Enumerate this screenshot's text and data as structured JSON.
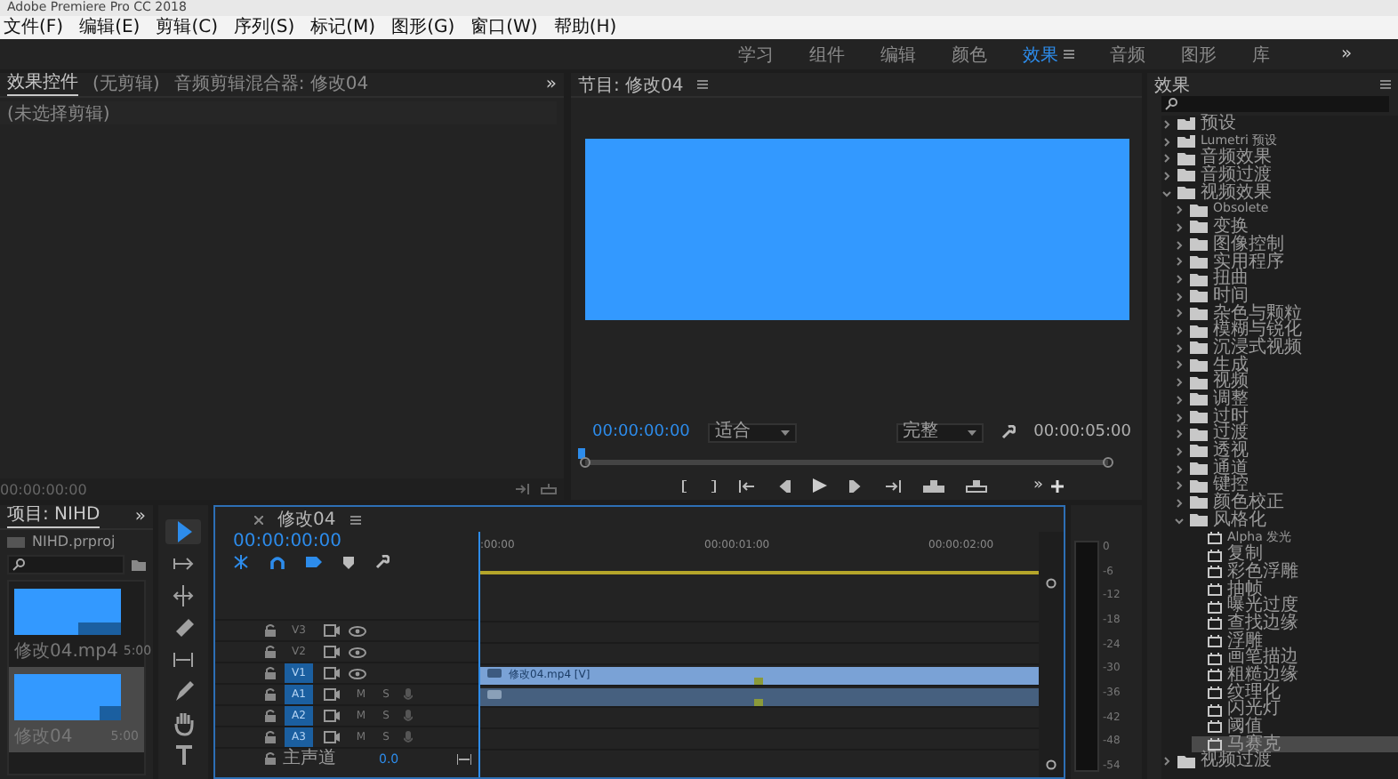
{
  "window": {
    "title": "Adobe Premiere Pro CC 2018"
  },
  "menu": [
    "文件(F)",
    "编辑(E)",
    "剪辑(C)",
    "序列(S)",
    "标记(M)",
    "图形(G)",
    "窗口(W)",
    "帮助(H)"
  ],
  "workspaces": [
    {
      "label": "学习",
      "selected": false
    },
    {
      "label": "组件",
      "selected": false
    },
    {
      "label": "编辑",
      "selected": false
    },
    {
      "label": "颜色",
      "selected": false
    },
    {
      "label": "效果",
      "selected": true
    },
    {
      "label": "音频",
      "selected": false
    },
    {
      "label": "图形",
      "selected": false
    },
    {
      "label": "库",
      "selected": false
    }
  ],
  "workspace_overflow": "»",
  "source_panel": {
    "tabs": [
      {
        "label": "效果控件",
        "selected": true
      },
      {
        "label": "(无剪辑)",
        "selected": false
      },
      {
        "label": "音频剪辑混合器: 修改04",
        "selected": false
      }
    ],
    "overflow": "»",
    "subheader": "(未选择剪辑)",
    "timecode": "00:00:00:00"
  },
  "program": {
    "title": "节目: 修改04",
    "timecode": "00:00:00:00",
    "zoom": "适合",
    "quality": "完整",
    "duration": "00:00:05:00",
    "overflow": "»"
  },
  "project": {
    "title": "项目: NIHD",
    "overflow": "»",
    "file": "NIHD.prproj",
    "items": [
      {
        "name": "修改04.mp4",
        "duration": "5:00",
        "kind": "clip",
        "selected": false
      },
      {
        "name": "修改04",
        "duration": "5:00",
        "kind": "sequence",
        "selected": true
      }
    ]
  },
  "tools": [
    {
      "kind": "select",
      "selected": true
    },
    {
      "kind": "track-select",
      "selected": false
    },
    {
      "kind": "ripple",
      "selected": false
    },
    {
      "kind": "razor",
      "selected": false
    },
    {
      "kind": "slip",
      "selected": false
    },
    {
      "kind": "pen",
      "selected": false
    },
    {
      "kind": "hand",
      "selected": false
    },
    {
      "kind": "type",
      "selected": false
    }
  ],
  "timeline": {
    "title": "修改04",
    "timecode": "00:00:00:00",
    "ruler": [
      ":00:00",
      "00:00:01:00",
      "00:00:02:00"
    ],
    "tracks": [
      {
        "kind": "video",
        "name": "V3",
        "targeted": false
      },
      {
        "kind": "video",
        "name": "V2",
        "targeted": false
      },
      {
        "kind": "video",
        "name": "V1",
        "targeted": true,
        "has_clip": true,
        "clip": "修改04.mp4 [V]"
      },
      {
        "kind": "audio",
        "name": "A1",
        "targeted": true,
        "mute": "M",
        "solo": "S",
        "has_clip": true
      },
      {
        "kind": "audio",
        "name": "A2",
        "targeted": true,
        "mute": "M",
        "solo": "S"
      },
      {
        "kind": "audio",
        "name": "A3",
        "targeted": true,
        "mute": "M",
        "solo": "S"
      },
      {
        "kind": "master",
        "name": "主声道",
        "value": "0.0"
      }
    ]
  },
  "meter": {
    "scale": [
      "0",
      "-6",
      "-12",
      "-18",
      "-24",
      "-30",
      "-36",
      "-42",
      "-48",
      "-54"
    ]
  },
  "effects": {
    "title": "效果",
    "tree": [
      {
        "label": "预设",
        "kind": "preset",
        "expanded": false,
        "selected": false
      },
      {
        "label": "Lumetri 预设",
        "kind": "preset",
        "expanded": false,
        "selected": false
      },
      {
        "label": "音频效果",
        "kind": "folder",
        "expanded": false,
        "selected": false
      },
      {
        "label": "音频过渡",
        "kind": "folder",
        "expanded": false,
        "selected": false
      },
      {
        "label": "视频效果",
        "kind": "folder",
        "expanded": true,
        "selected": false,
        "children": [
          {
            "label": "Obsolete",
            "kind": "folder",
            "expanded": false,
            "selected": false
          },
          {
            "label": "变换",
            "kind": "folder",
            "expanded": false,
            "selected": false
          },
          {
            "label": "图像控制",
            "kind": "folder",
            "expanded": false,
            "selected": false
          },
          {
            "label": "实用程序",
            "kind": "folder",
            "expanded": false,
            "selected": false
          },
          {
            "label": "扭曲",
            "kind": "folder",
            "expanded": false,
            "selected": false
          },
          {
            "label": "时间",
            "kind": "folder",
            "expanded": false,
            "selected": false
          },
          {
            "label": "杂色与颗粒",
            "kind": "folder",
            "expanded": false,
            "selected": false
          },
          {
            "label": "模糊与锐化",
            "kind": "folder",
            "expanded": false,
            "selected": false
          },
          {
            "label": "沉浸式视频",
            "kind": "folder",
            "expanded": false,
            "selected": false
          },
          {
            "label": "生成",
            "kind": "folder",
            "expanded": false,
            "selected": false
          },
          {
            "label": "视频",
            "kind": "folder",
            "expanded": false,
            "selected": false
          },
          {
            "label": "调整",
            "kind": "folder",
            "expanded": false,
            "selected": false
          },
          {
            "label": "过时",
            "kind": "folder",
            "expanded": false,
            "selected": false
          },
          {
            "label": "过渡",
            "kind": "folder",
            "expanded": false,
            "selected": false
          },
          {
            "label": "透视",
            "kind": "folder",
            "expanded": false,
            "selected": false
          },
          {
            "label": "通道",
            "kind": "folder",
            "expanded": false,
            "selected": false
          },
          {
            "label": "键控",
            "kind": "folder",
            "expanded": false,
            "selected": false
          },
          {
            "label": "颜色校正",
            "kind": "folder",
            "expanded": false,
            "selected": false
          },
          {
            "label": "风格化",
            "kind": "folder",
            "expanded": true,
            "selected": false,
            "children": [
              {
                "label": "Alpha 发光",
                "kind": "effect",
                "selected": false
              },
              {
                "label": "复制",
                "kind": "effect",
                "selected": false
              },
              {
                "label": "彩色浮雕",
                "kind": "effect",
                "selected": false
              },
              {
                "label": "抽帧",
                "kind": "effect",
                "selected": false
              },
              {
                "label": "曝光过度",
                "kind": "effect",
                "selected": false
              },
              {
                "label": "查找边缘",
                "kind": "effect",
                "selected": false
              },
              {
                "label": "浮雕",
                "kind": "effect",
                "selected": false
              },
              {
                "label": "画笔描边",
                "kind": "effect",
                "selected": false
              },
              {
                "label": "粗糙边缘",
                "kind": "effect",
                "selected": false
              },
              {
                "label": "纹理化",
                "kind": "effect",
                "selected": false
              },
              {
                "label": "闪光灯",
                "kind": "effect",
                "selected": false
              },
              {
                "label": "阈值",
                "kind": "effect",
                "selected": false
              },
              {
                "label": "马赛克",
                "kind": "effect",
                "selected": true
              }
            ]
          }
        ]
      },
      {
        "label": "视频过渡",
        "kind": "folder",
        "expanded": false,
        "selected": false
      }
    ]
  }
}
